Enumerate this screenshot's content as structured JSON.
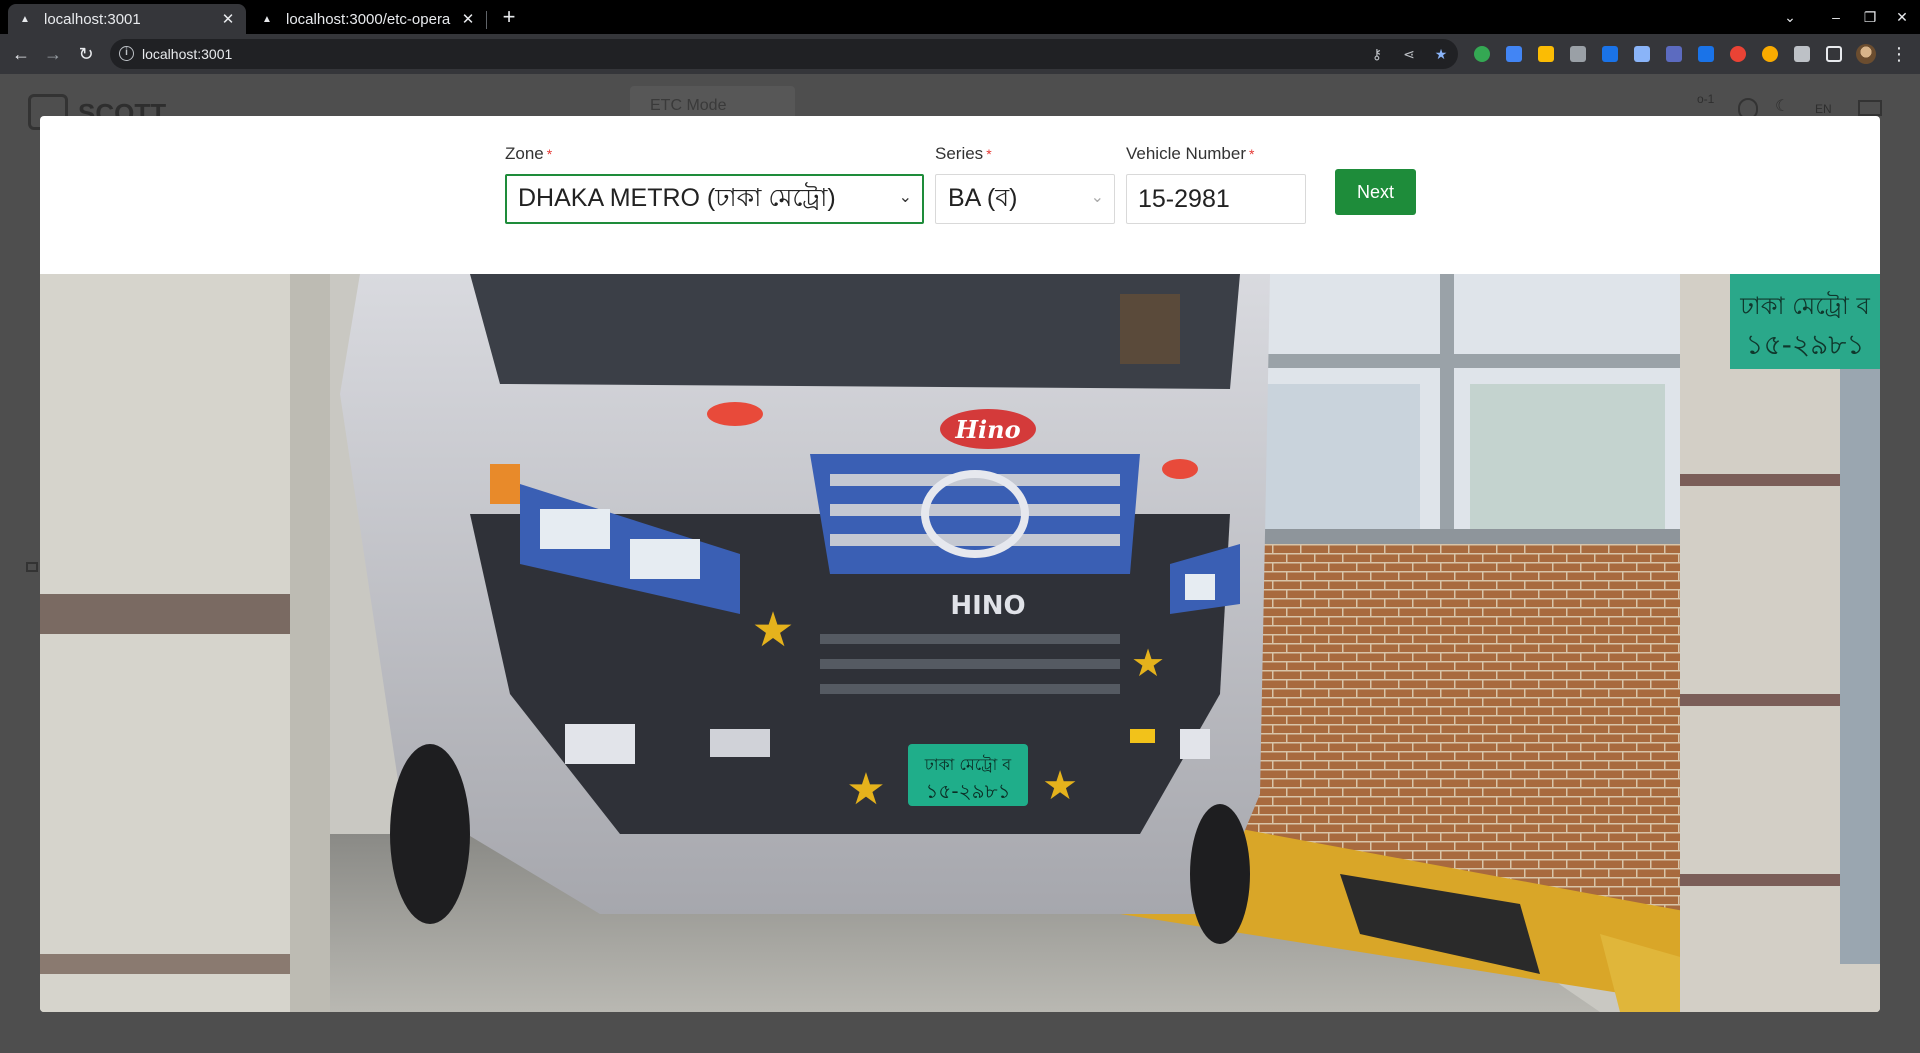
{
  "browser": {
    "tabs": [
      {
        "title": "localhost:3001",
        "active": true
      },
      {
        "title": "localhost:3000/etc-opera",
        "active": false
      }
    ],
    "url": "localhost:3001"
  },
  "background_app": {
    "brand": "SCOTT",
    "mode_label": "ETC Mode",
    "top_right_code": "o-1",
    "language": "EN"
  },
  "form": {
    "zone": {
      "label": "Zone",
      "value": "DHAKA METRO (ঢাকা মেট্রো)"
    },
    "series": {
      "label": "Series",
      "value": "BA (ব)"
    },
    "vehicle_number": {
      "label": "Vehicle Number",
      "value": "15-2981"
    },
    "next_label": "Next",
    "required_mark": "*"
  },
  "camera_image": {
    "plate_line1": "ঢাকা মেট্রো ব",
    "plate_line2": "১৫-২৯৮১",
    "brand_badge": "Hino",
    "grille_text": "HINO",
    "plate_color": "#1fae8a"
  }
}
